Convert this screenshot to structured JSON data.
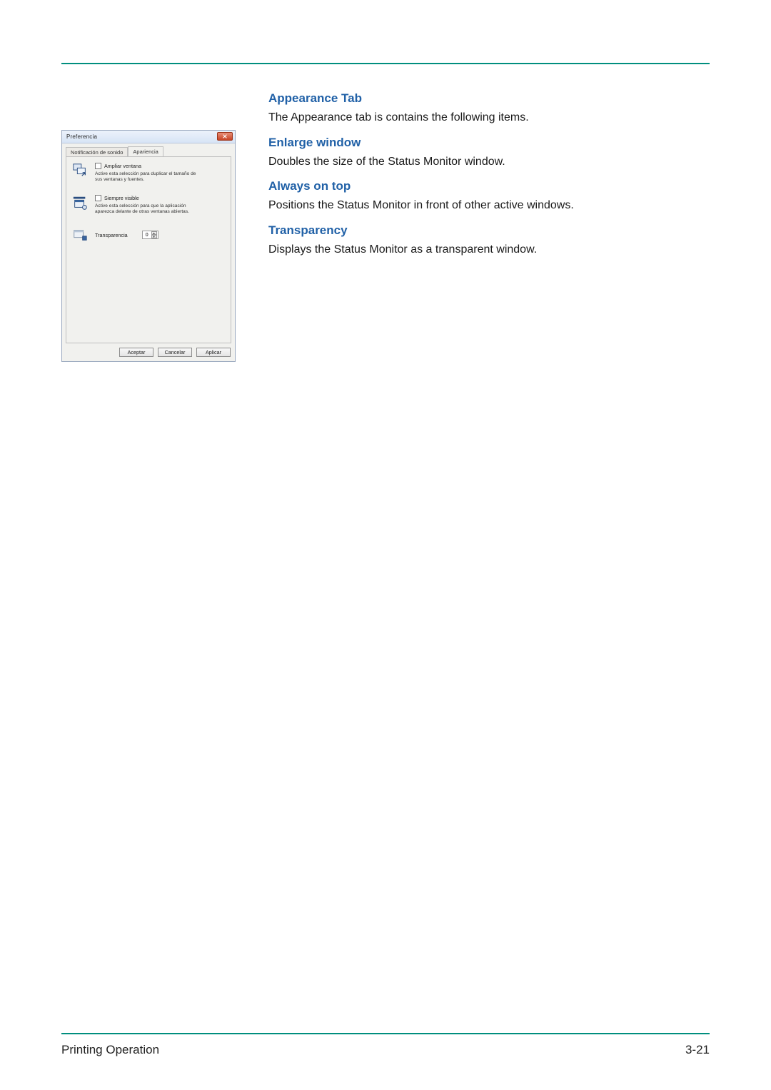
{
  "headings": {
    "appearance": "Appearance Tab",
    "enlarge": "Enlarge window",
    "always": "Always on top",
    "transparency": "Transparency"
  },
  "paragraphs": {
    "appearance": "The Appearance tab is contains the following items.",
    "enlarge": "Doubles the size of the Status Monitor window.",
    "always": "Positions the Status Monitor in front of other active windows.",
    "transparency": "Displays the Status Monitor as a transparent window."
  },
  "footer": {
    "left": "Printing Operation",
    "right": "3-21"
  },
  "dialog": {
    "title": "Preferencia",
    "tabs": {
      "sound": "Notificación de sonido",
      "appearance": "Apariencia"
    },
    "options": {
      "enlarge": {
        "label": "Ampliar ventana",
        "desc": "Active esta selección para duplicar el tamaño de sus ventanas y fuentes."
      },
      "ontop": {
        "label": "Siempre visible",
        "desc": "Active esta selección para que la aplicación aparezca delante de otras ventanas abiertas."
      },
      "transparency": {
        "label": "Transparencia",
        "value": "0"
      }
    },
    "buttons": {
      "ok": "Aceptar",
      "cancel": "Cancelar",
      "apply": "Aplicar"
    }
  }
}
